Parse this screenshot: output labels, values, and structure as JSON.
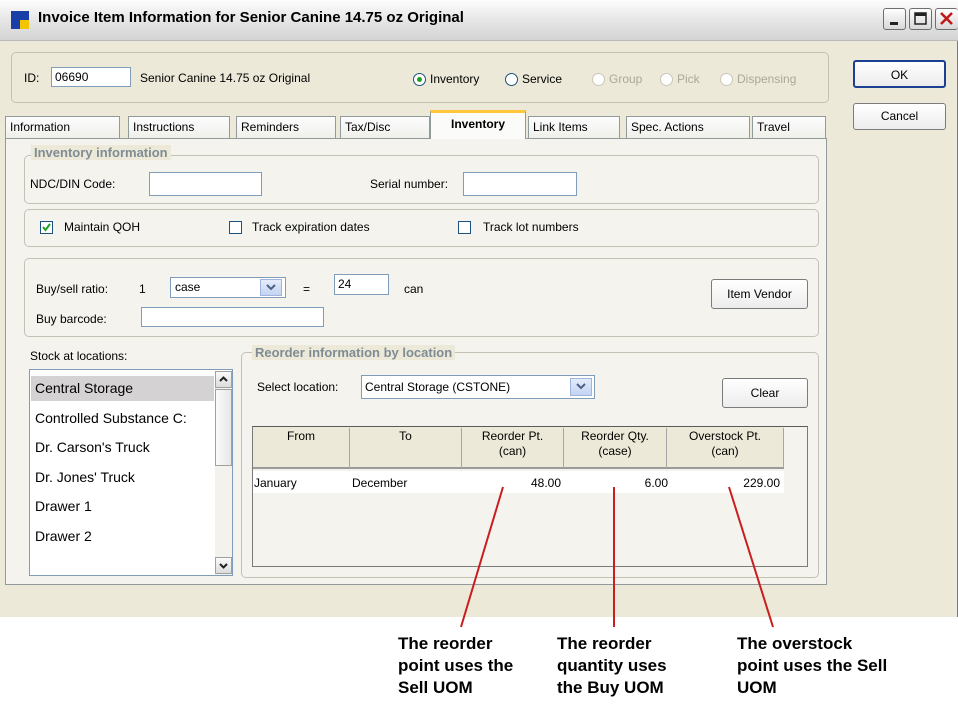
{
  "window": {
    "title": "Invoice Item Information for Senior Canine 14.75 oz Original"
  },
  "header": {
    "id_label": "ID:",
    "id_value": "06690",
    "item_name": "Senior Canine 14.75 oz Original",
    "types": [
      "Inventory",
      "Service",
      "Group",
      "Pick",
      "Dispensing"
    ],
    "selected_type": "Inventory"
  },
  "buttons": {
    "ok": "OK",
    "cancel": "Cancel",
    "item_vendor": "Item Vendor",
    "clear": "Clear"
  },
  "tabs": [
    "Information",
    "Instructions",
    "Reminders",
    "Tax/Disc",
    "Inventory",
    "Link Items",
    "Spec. Actions",
    "Travel"
  ],
  "active_tab": "Inventory",
  "inventory_info": {
    "group_title": "Inventory information",
    "ndc_label": "NDC/DIN Code:",
    "ndc_value": "",
    "serial_label": "Serial number:",
    "serial_value": ""
  },
  "tracking": {
    "maintain_qoh": {
      "label": "Maintain QOH",
      "checked": true
    },
    "track_expiration": {
      "label": "Track expiration dates",
      "checked": false
    },
    "track_lot": {
      "label": "Track lot numbers",
      "checked": false
    }
  },
  "buysell": {
    "ratio_label": "Buy/sell ratio:",
    "ratio_left": "1",
    "buy_uom": "case",
    "equals": "=",
    "ratio_right": "24",
    "sell_uom": "can",
    "barcode_label": "Buy barcode:",
    "barcode_value": ""
  },
  "stock": {
    "label": "Stock at locations:",
    "locations": [
      "Central Storage",
      "Controlled Substance C:",
      "Dr. Carson's Truck",
      "Dr. Jones' Truck",
      "Drawer 1",
      "Drawer 2"
    ],
    "selected": "Central Storage"
  },
  "reorder": {
    "group_title": "Reorder information by location",
    "select_label": "Select location:",
    "selected_location": "Central Storage (CSTONE)",
    "columns": [
      {
        "line1": "From",
        "line2": ""
      },
      {
        "line1": "To",
        "line2": ""
      },
      {
        "line1": "Reorder Pt.",
        "line2": "(can)"
      },
      {
        "line1": "Reorder Qty.",
        "line2": "(case)"
      },
      {
        "line1": "Overstock Pt.",
        "line2": "(can)"
      }
    ],
    "rows": [
      {
        "from": "January",
        "to": "December",
        "reorder_pt": "48.00",
        "reorder_qty": "6.00",
        "overstock_pt": "229.00"
      }
    ]
  },
  "annotations": {
    "reorder_point": "The reorder point uses the Sell UOM",
    "reorder_quantity": "The reorder quantity uses the Buy UOM",
    "overstock_point": "The overstock point uses the Sell UOM",
    "line_color": "#c81e1e"
  }
}
